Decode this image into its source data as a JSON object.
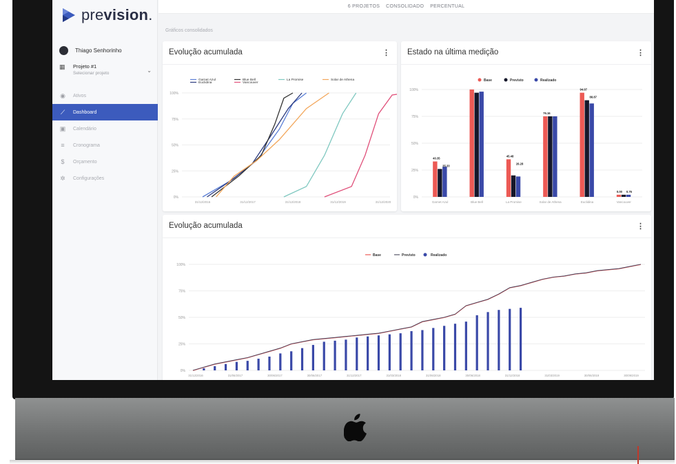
{
  "app": {
    "logo_prefix": "pre",
    "logo_bold": "vision",
    "logo_dot": ".",
    "user_name": "Thiago Senhorinho",
    "project_title": "Projeto #1",
    "project_subtitle": "Selecionar projeto"
  },
  "sidebar": {
    "items": [
      {
        "label": "Ativos",
        "icon": "eye-icon",
        "active": false
      },
      {
        "label": "Dashboard",
        "icon": "chart-icon",
        "active": true
      },
      {
        "label": "Calendário",
        "icon": "calendar-icon",
        "active": false
      },
      {
        "label": "Cronograma",
        "icon": "list-icon",
        "active": false
      },
      {
        "label": "Orçamento",
        "icon": "money-icon",
        "active": false
      },
      {
        "label": "Configurações",
        "icon": "gear-icon",
        "active": false
      }
    ]
  },
  "topbar": {
    "tabs": [
      "6 PROJETOS",
      "CONSOLIDADO",
      "PERCENTUAL"
    ]
  },
  "section_title": "Gráficos consolidados",
  "cards": {
    "card1_title": "Evolução acumulada",
    "card2_title": "Estado na última medição",
    "card3_title": "Evolução acumulada"
  },
  "colors": {
    "accent": "#3c5bbd",
    "base": "#ec5a55",
    "previsto": "#15172a",
    "realizado": "#3a49a8"
  },
  "chart_data": [
    {
      "type": "line",
      "y_ticks": [
        "100%",
        "75%",
        "50%",
        "25%",
        "0%"
      ],
      "x_ticks": [
        "31/12/2016",
        "31/12/2017",
        "31/12/2018",
        "31/12/2019",
        "31/12/2020"
      ],
      "ylim": [
        0,
        100
      ],
      "series": [
        {
          "name": "Garnet Azul",
          "color": "#5b7fd6",
          "values": [
            [
              0,
              0
            ],
            [
              0.6,
              15
            ],
            [
              1.2,
              35
            ],
            [
              1.7,
              65
            ],
            [
              2.0,
              90
            ],
            [
              2.3,
              100
            ]
          ]
        },
        {
          "name": "Euclidina",
          "color": "#2b3a7e",
          "values": [
            [
              0.1,
              0
            ],
            [
              0.7,
              18
            ],
            [
              1.1,
              32
            ],
            [
              1.5,
              58
            ],
            [
              1.9,
              85
            ],
            [
              2.2,
              100
            ]
          ]
        },
        {
          "name": "Blue Bell",
          "color": "#333333",
          "values": [
            [
              0.2,
              0
            ],
            [
              0.8,
              20
            ],
            [
              1.3,
              40
            ],
            [
              1.6,
              70
            ],
            [
              1.8,
              95
            ],
            [
              2.0,
              100
            ]
          ]
        },
        {
          "name": "Vancouver",
          "color": "#e0507a",
          "values": [
            [
              2.7,
              0
            ],
            [
              3.3,
              10
            ],
            [
              3.6,
              40
            ],
            [
              3.9,
              80
            ],
            [
              4.2,
              98
            ],
            [
              4.5,
              100
            ]
          ]
        },
        {
          "name": "La Promise",
          "color": "#7fc8c0",
          "values": [
            [
              1.8,
              0
            ],
            [
              2.3,
              10
            ],
            [
              2.7,
              40
            ],
            [
              3.1,
              80
            ],
            [
              3.4,
              100
            ]
          ]
        },
        {
          "name": "Solar de Athena",
          "color": "#f2a65a",
          "values": [
            [
              0.3,
              0
            ],
            [
              0.7,
              20
            ],
            [
              1.2,
              35
            ],
            [
              1.7,
              55
            ],
            [
              2.3,
              85
            ],
            [
              2.8,
              100
            ]
          ]
        }
      ]
    },
    {
      "type": "bar",
      "legend": [
        "Base",
        "Previsto",
        "Realizado"
      ],
      "y_ticks": [
        "100%",
        "75%",
        "50%",
        "25%",
        "0%"
      ],
      "ylim": [
        0,
        100
      ],
      "categories": [
        "Garnet Azul",
        "Blue Bell",
        "La Promise",
        "Solar de Athena",
        "Euclidina",
        "Vancouver"
      ],
      "series": [
        {
          "name": "Base",
          "values": [
            33,
            100,
            35,
            75,
            97,
            2
          ]
        },
        {
          "name": "Previsto",
          "values": [
            26,
            97,
            20,
            75,
            90,
            2
          ]
        },
        {
          "name": "Realizado",
          "values": [
            28,
            98,
            19,
            75,
            87,
            2
          ]
        }
      ],
      "data_labels": [
        {
          "category": "Garnet Azul",
          "text": "40.35"
        },
        {
          "category": "Garnet Azul",
          "text": "35.33"
        },
        {
          "category": "La Promise",
          "text": "45.48"
        },
        {
          "category": "La Promise",
          "text": "26.28"
        },
        {
          "category": "Solar de Athena",
          "text": "76.16"
        },
        {
          "category": "Euclidina",
          "text": "94.97"
        },
        {
          "category": "Euclidina",
          "text": "88.87"
        },
        {
          "category": "Vancouver",
          "text": "0.00"
        },
        {
          "category": "Vancouver",
          "text": "0.76"
        }
      ]
    },
    {
      "type": "line",
      "legend": [
        "Base",
        "Previsto",
        "Realizado"
      ],
      "y_ticks": [
        "100%",
        "75%",
        "50%",
        "25%",
        "0%"
      ],
      "x_ticks": [
        "31/12/2016",
        "31/06/2017",
        "30/06/2017",
        "30/06/2017",
        "31/12/2017",
        "31/03/2018",
        "31/06/2018",
        "30/06/2018",
        "31/12/2018",
        "31/03/2019",
        "30/06/2019",
        "30/09/2019"
      ],
      "ylim": [
        0,
        100
      ],
      "line_values": [
        0,
        3,
        6,
        8,
        10,
        12,
        15,
        18,
        21,
        25,
        27,
        29,
        30,
        31,
        32,
        33,
        34,
        35,
        37,
        39,
        41,
        46,
        48,
        50,
        53,
        61,
        64,
        67,
        72,
        78,
        80,
        83,
        86,
        88,
        89,
        91,
        92,
        94,
        95,
        96,
        98,
        100
      ],
      "bar_values": [
        2,
        4,
        6,
        8,
        9,
        11,
        13,
        16,
        18,
        21,
        24,
        27,
        28,
        29,
        31,
        32,
        33,
        34,
        35,
        37,
        38,
        40,
        42,
        44,
        46,
        52,
        55,
        57,
        58,
        59
      ]
    }
  ]
}
